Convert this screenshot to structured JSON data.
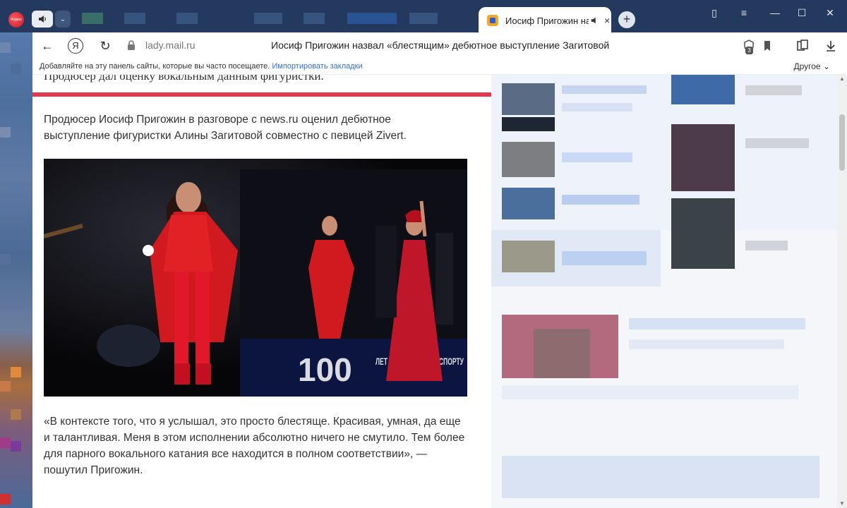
{
  "tabs": {
    "app_logo_text": "Яндекс",
    "active_tab_title": "Иосиф Пригожин на",
    "audio_icon": "speaker-icon",
    "close_label": "×",
    "new_tab_label": "+"
  },
  "window_controls": {
    "bookmarks_icon": "▯",
    "menu_icon": "≡",
    "minimize": "—",
    "maximize": "☐",
    "close": "✕"
  },
  "addressbar": {
    "back": "←",
    "yandex_button": "Я",
    "reload": "↻",
    "url": "lady.mail.ru",
    "page_title": "Иосиф Пригожин назвал «блестящим» дебютное выступление Загитовой",
    "protect_badge": "3"
  },
  "bookmarks_bar": {
    "hint": "Добавляйте на эту панель сайты, которые вы часто посещаете.",
    "import_link": "Импортировать закладки",
    "other": "Другое"
  },
  "article": {
    "cut_heading": "Продюсер дал оценку вокальным данным фигуристки.",
    "paragraph1": "Продюсер Иосиф Пригожин в разговоре с news.ru оценил дебютное выступление фигуристки Алины Загитовой совместно с певицей Zivert.",
    "photo_banner_number": "100",
    "photo_banner_text": "ЛЕТ МОСКОВСКОМУ СПОРТУ",
    "paragraph2": "«В контексте того, что я услышал, это просто блестяще. Красивая, умная, да еще и талантливая. Меня в этом исполнении абсолютно ничего не смутило. Тем более для парного вокального катания все находится в полном соответствии», — пошутил Пригожин."
  },
  "colors": {
    "accent_red": "#e63950",
    "link_blue": "#2f6fd6",
    "tabbar_bg": "#233a5e"
  }
}
